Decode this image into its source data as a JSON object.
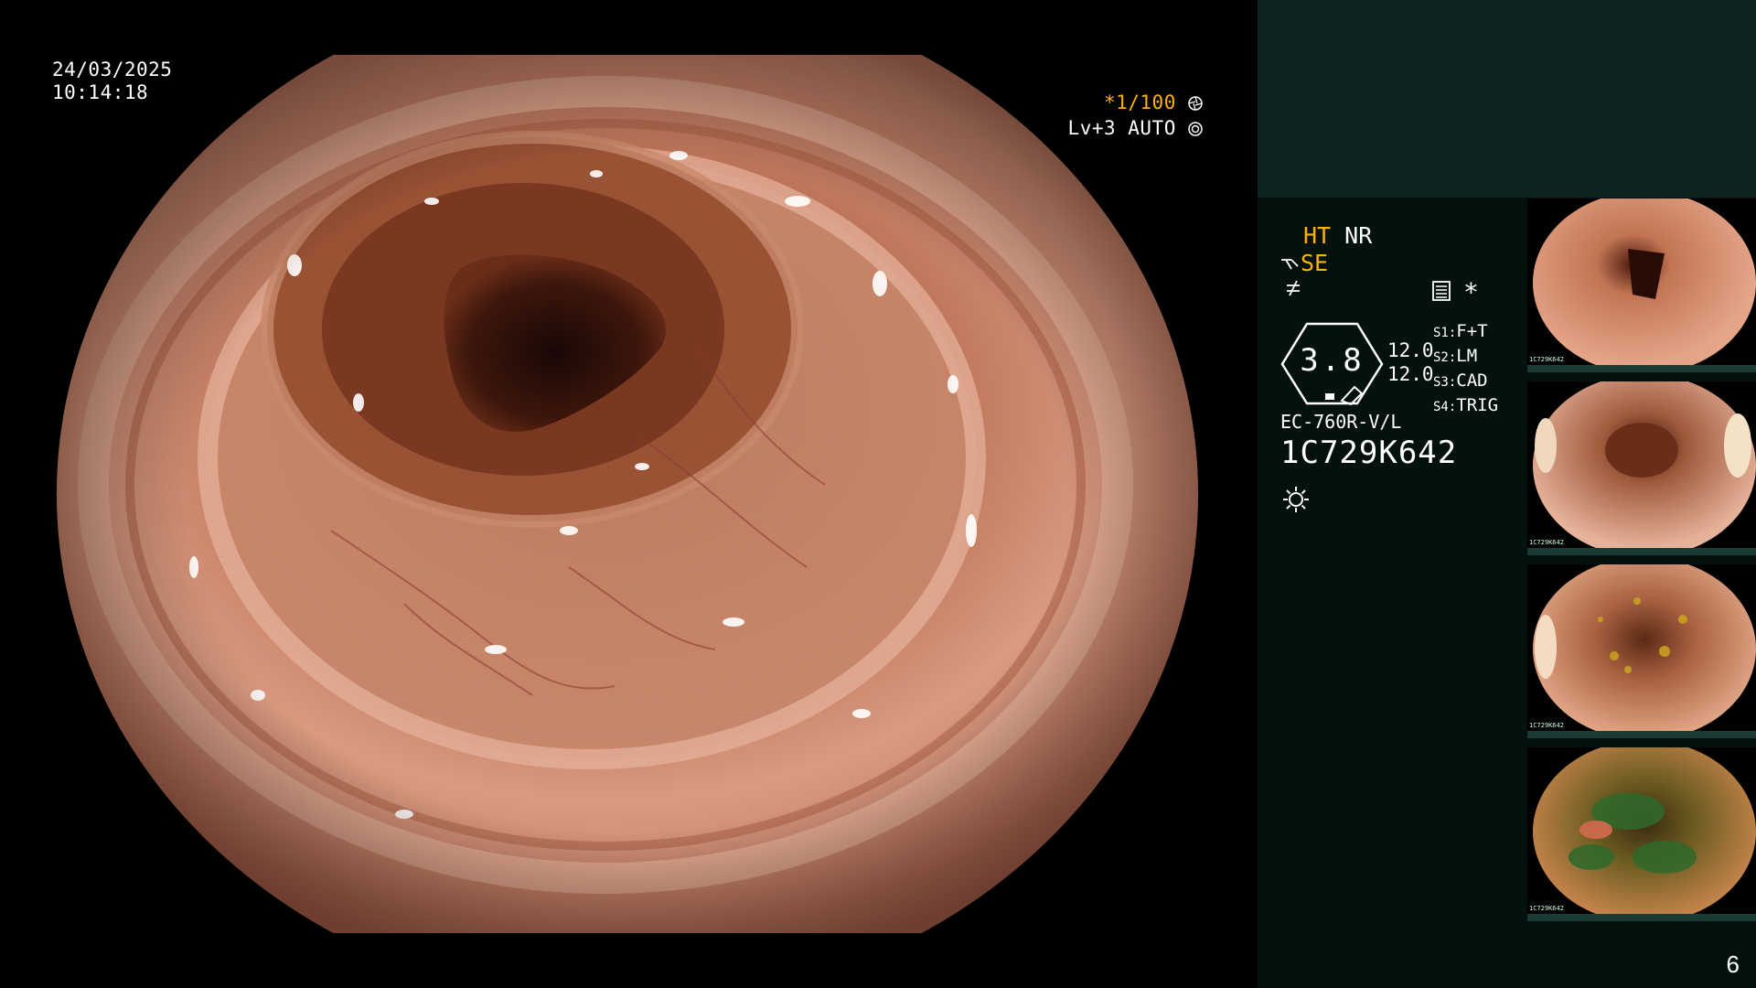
{
  "overlay": {
    "date": "24/03/2025",
    "time": "10:14:18",
    "shutter": "*1/100",
    "shutter_icon": "aperture-icon",
    "level_mode": "Lv+3 AUTO",
    "level_icon": "iris-icon"
  },
  "panel": {
    "ht": "HT",
    "nr": "NR",
    "se": "SE",
    "gauge_value": "3.8",
    "sub_value_1": "12.0",
    "sub_value_2": "12.0",
    "switches": [
      {
        "key": "S1:",
        "value": "F+T"
      },
      {
        "key": "S2:",
        "value": "LM"
      },
      {
        "key": "S3:",
        "value": "CAD"
      },
      {
        "key": "S4:",
        "value": "TRIG"
      }
    ],
    "scope_model": "EC-760R-V/L",
    "scope_serial": "1C729K642",
    "star": "*"
  },
  "thumbnails": [
    {
      "serial": "1C729K642"
    },
    {
      "serial": "1C729K642"
    },
    {
      "serial": "1C729K642"
    },
    {
      "serial": "1C729K642"
    }
  ],
  "page_number": "6",
  "colors": {
    "accent_orange": "#ffb300",
    "panel_bg": "#04110f",
    "panel_top": "#0e2322"
  }
}
